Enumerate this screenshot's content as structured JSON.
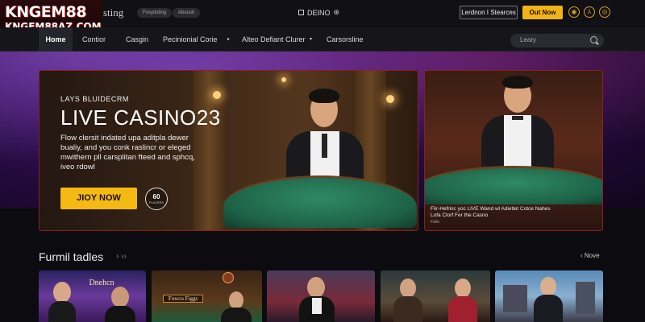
{
  "topbar": {
    "logo_line1": "KNGEM88",
    "logo_line2": "KNGEM88AZ.COM",
    "brand_suffix": "sting",
    "pill1": "Fosydsting",
    "pill2": "Abousit",
    "center_title": "DEINO",
    "center_mark": "⊛",
    "outline_button": "Lerdnon I Stearces",
    "cta_button": "Out Now",
    "icon1": "◉",
    "icon2": "⅄",
    "icon3": "◎"
  },
  "nav": {
    "items": [
      "Home",
      "Contior",
      "Casgin",
      "Pecinionial Corie",
      "Alteo Defiant Clurer",
      "Carsorsline"
    ],
    "search_placeholder": "Leary"
  },
  "hero": {
    "subtitle": "LAYS BLUIDECRM",
    "title": "LIVE CASINO23",
    "description": "Flow clersit indated upa aditpla dewer bualiy, and you conk raslincr or eleged mwithern pll carsplitan fteed and sphcq, iveo rdowl",
    "cta": "JIOY NOW",
    "badge_number": "60",
    "badge_text": "PLAYERS"
  },
  "side_card": {
    "caption_line1": "Flir-Hefrinc yoc LIVE Wand wl Adietlet Cotce Nahes",
    "caption_line2": "Lofa Clorf Fer the Casno",
    "caption_small": "Fafo"
  },
  "section": {
    "title": "Furmil tadles",
    "arrows": "›  ››",
    "view_more": "‹   Nove",
    "thumb2_label": "Fowco Figgs",
    "thumb1_label": "Dnehcn"
  }
}
